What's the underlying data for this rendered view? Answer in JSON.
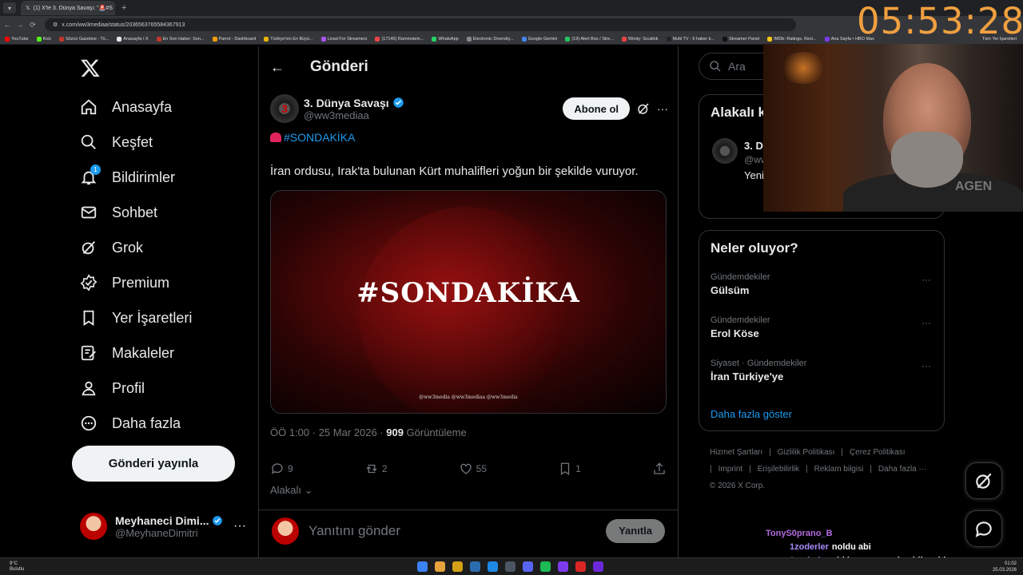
{
  "browser": {
    "tab_title": "(1) X'te 3. Dünya Savaşı: \"🚨#S",
    "url": "x.com/ww3mediaa/status/2036563765584367913",
    "bookmarks": [
      "YouTube",
      "Kick",
      "Sözcü Gazetesi - Tü...",
      "Anasayfa / X",
      "En Son Haber: Son...",
      "Parrot - Dashboard",
      "Türkiye'nin En Büyü...",
      "Livad For Streamers",
      "(17145) Rammstein...",
      "WhatsApp",
      "Electronic Diversity...",
      "Google Gemini",
      "(19) Alert Box / Stre...",
      "Windy: Sıcaklık",
      "Multi TV - 6 haber k...",
      "Streamer Panel",
      "IMDb: Ratings, Revi...",
      "Ana Sayfa • HBO Max"
    ],
    "bookmarks_all": "Tüm Yer İşaretleri"
  },
  "nav": {
    "items": [
      {
        "label": "Anasayfa",
        "icon": "home-icon"
      },
      {
        "label": "Keşfet",
        "icon": "search-icon"
      },
      {
        "label": "Bildirimler",
        "icon": "bell-icon",
        "badge": "1"
      },
      {
        "label": "Sohbet",
        "icon": "mail-icon"
      },
      {
        "label": "Grok",
        "icon": "grok-icon"
      },
      {
        "label": "Premium",
        "icon": "premium-icon"
      },
      {
        "label": "Yer İşaretleri",
        "icon": "bookmark-icon"
      },
      {
        "label": "Makaleler",
        "icon": "article-icon"
      },
      {
        "label": "Profil",
        "icon": "profile-icon"
      },
      {
        "label": "Daha fazla",
        "icon": "more-icon"
      }
    ],
    "post_button": "Gönderi yayınla",
    "account_name": "Meyhaneci Dimi...",
    "account_handle": "@MeyhaneDimitri"
  },
  "main": {
    "title": "Gönderi",
    "author_name": "3. Dünya Savaşı",
    "author_handle": "@ww3mediaa",
    "follow_label": "Abone ol",
    "hashtag": "#SONDAKİKA",
    "text": "İran ordusu, Irak'ta bulunan Kürt muhalifleri yoğun bir şekilde vuruyor.",
    "media_title": "#SONDAKİKA",
    "media_footer": "@ww3media   @ww3mediaa   @ww3media",
    "timestamp": "ÖÖ 1:00 · 25 Mar 2026 · ",
    "views": "909",
    "views_label": " Görüntüleme",
    "replies": "9",
    "reposts": "2",
    "likes": "55",
    "bookmarks": "1",
    "relevant_label": "Alakalı",
    "reply_placeholder": "Yanıtını gönder",
    "reply_button": "Yanıtla"
  },
  "right": {
    "search_placeholder": "Ara",
    "related_title": "Alakalı k",
    "related_name": "3. D",
    "related_handle": "@ww",
    "related_bio": "Yeni Yurt info",
    "trends_title": "Neler oluyor?",
    "trends": [
      {
        "category": "Gündemdekiler",
        "name": "Gülsüm"
      },
      {
        "category": "Gündemdekiler",
        "name": "Erol Köse"
      },
      {
        "category": "Siyaset · Gündemdekiler",
        "name": "İran Türkiye'ye"
      }
    ],
    "show_more": "Daha fazla göster",
    "footer": [
      "Hizmet Şartları",
      "|",
      "Gizlilik Politikası",
      "|",
      "Çerez Politikası",
      "|",
      "Imprint",
      "|",
      "Erişilebilirlik",
      "|",
      "Reklam bilgisi",
      "|",
      "Daha fazla ···",
      "© 2026 X Corp."
    ]
  },
  "overlay": {
    "timer": "05:53:28",
    "cam_text": "AGEN",
    "chat": [
      {
        "user": "TonyS0prano_B",
        "msg": ""
      },
      {
        "user": "1zoderler",
        "msg": "noldu abi"
      },
      {
        "user": "1zoderler",
        "msg": "abi ben eve yeni geldim abi"
      }
    ]
  },
  "taskbar": {
    "weather_temp": "9°C",
    "weather_desc": "Bulutlu",
    "time": "01:02",
    "date": "25.03.2026"
  },
  "colors": {
    "accent": "#1d9bf0",
    "background": "#000000",
    "border": "#2f3336",
    "muted_text": "#71767b",
    "timer": "#f0a040"
  }
}
